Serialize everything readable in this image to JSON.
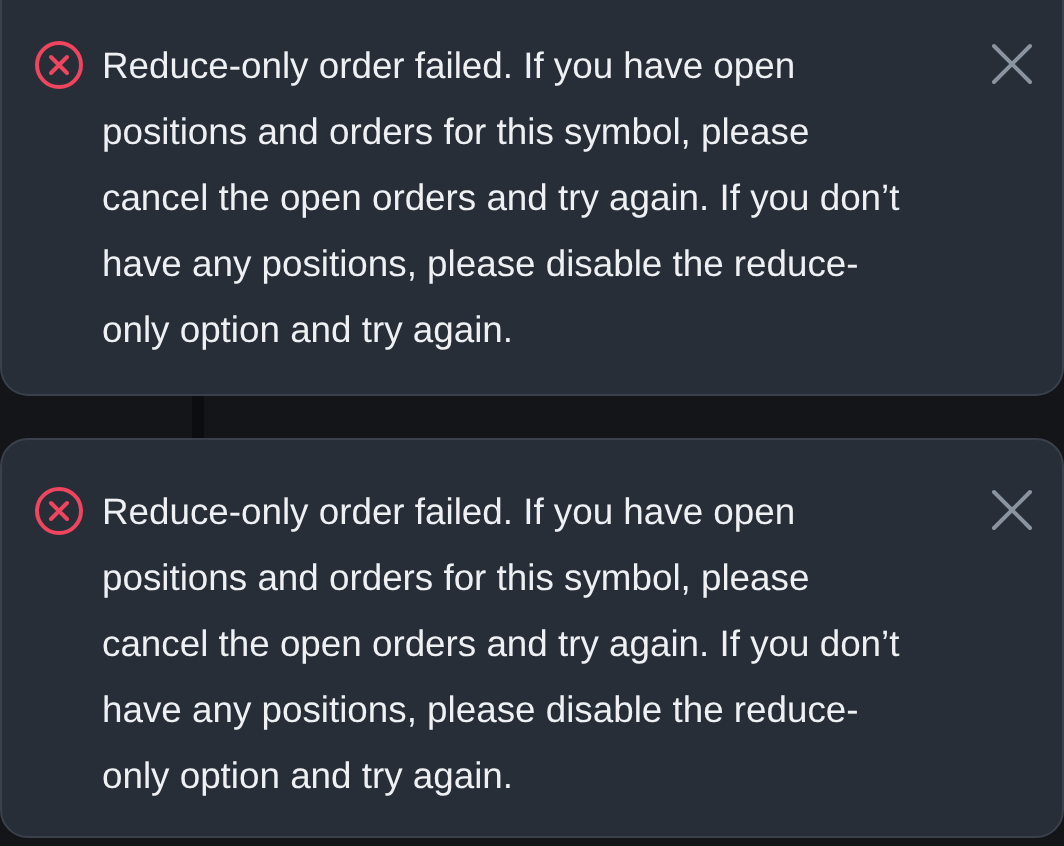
{
  "toasts": [
    {
      "kind": "error",
      "message": "Reduce-only order failed. If you have open positions and orders for this symbol, please cancel the open orders and try again. If you don’t have any positions, please disable the reduce-only option and try again."
    },
    {
      "kind": "error",
      "message": "Reduce-only order failed. If you have open positions and orders for this symbol, please cancel the open orders and try again. If you don’t have any positions, please disable the reduce-only option and try again."
    }
  ]
}
